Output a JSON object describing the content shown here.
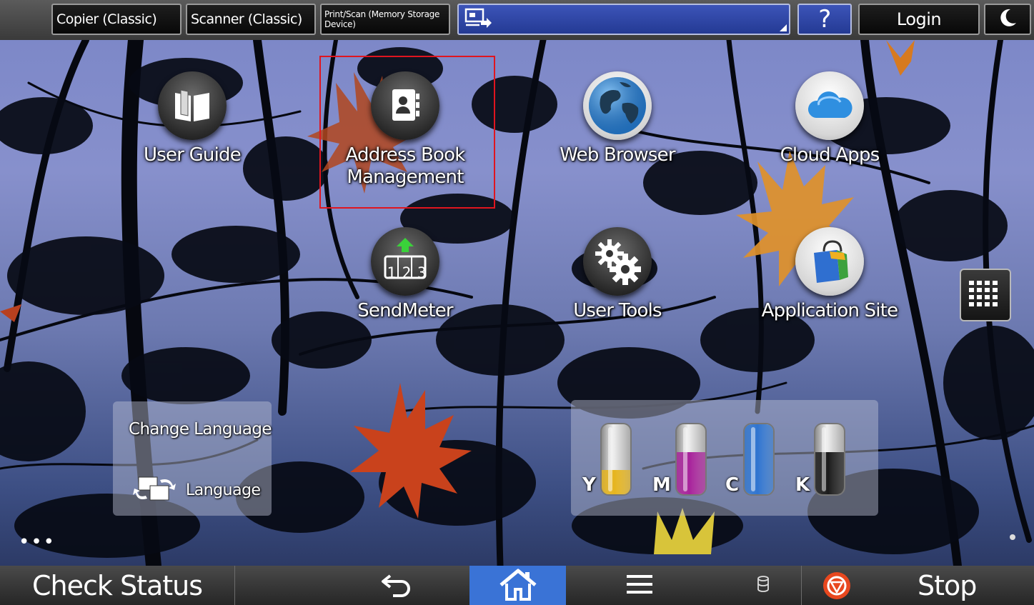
{
  "topbar": {
    "tabs": [
      {
        "label": "Copier (Classic)"
      },
      {
        "label": "Scanner (Classic)"
      },
      {
        "label": "Print/Scan (Memory Storage Device)"
      }
    ],
    "help_label": "?",
    "login_label": "Login"
  },
  "apps": [
    {
      "label": "User Guide"
    },
    {
      "label": "Address Book Management"
    },
    {
      "label": "Web Browser"
    },
    {
      "label": "Cloud Apps"
    },
    {
      "label": "SendMeter"
    },
    {
      "label": "User Tools"
    },
    {
      "label": "Application Site"
    }
  ],
  "sendmeter_digits": "1 2 3",
  "language_widget": {
    "title": "Change Language",
    "button_label": "Language"
  },
  "toner": {
    "items": [
      {
        "letter": "Y",
        "level": 0.35,
        "color": "#e6b51f"
      },
      {
        "letter": "M",
        "level": 0.6,
        "color": "#a8239b"
      },
      {
        "letter": "C",
        "level": 1.0,
        "color": "#2f74d0"
      },
      {
        "letter": "K",
        "level": 0.6,
        "color": "#1b1b1b"
      }
    ]
  },
  "page_dots": "•••",
  "bottombar": {
    "check_status_label": "Check Status",
    "stop_label": "Stop"
  },
  "colors": {
    "highlight": "#e0151f",
    "home_active": "#3a73d6",
    "topbar_blue": "#2e45a6"
  }
}
